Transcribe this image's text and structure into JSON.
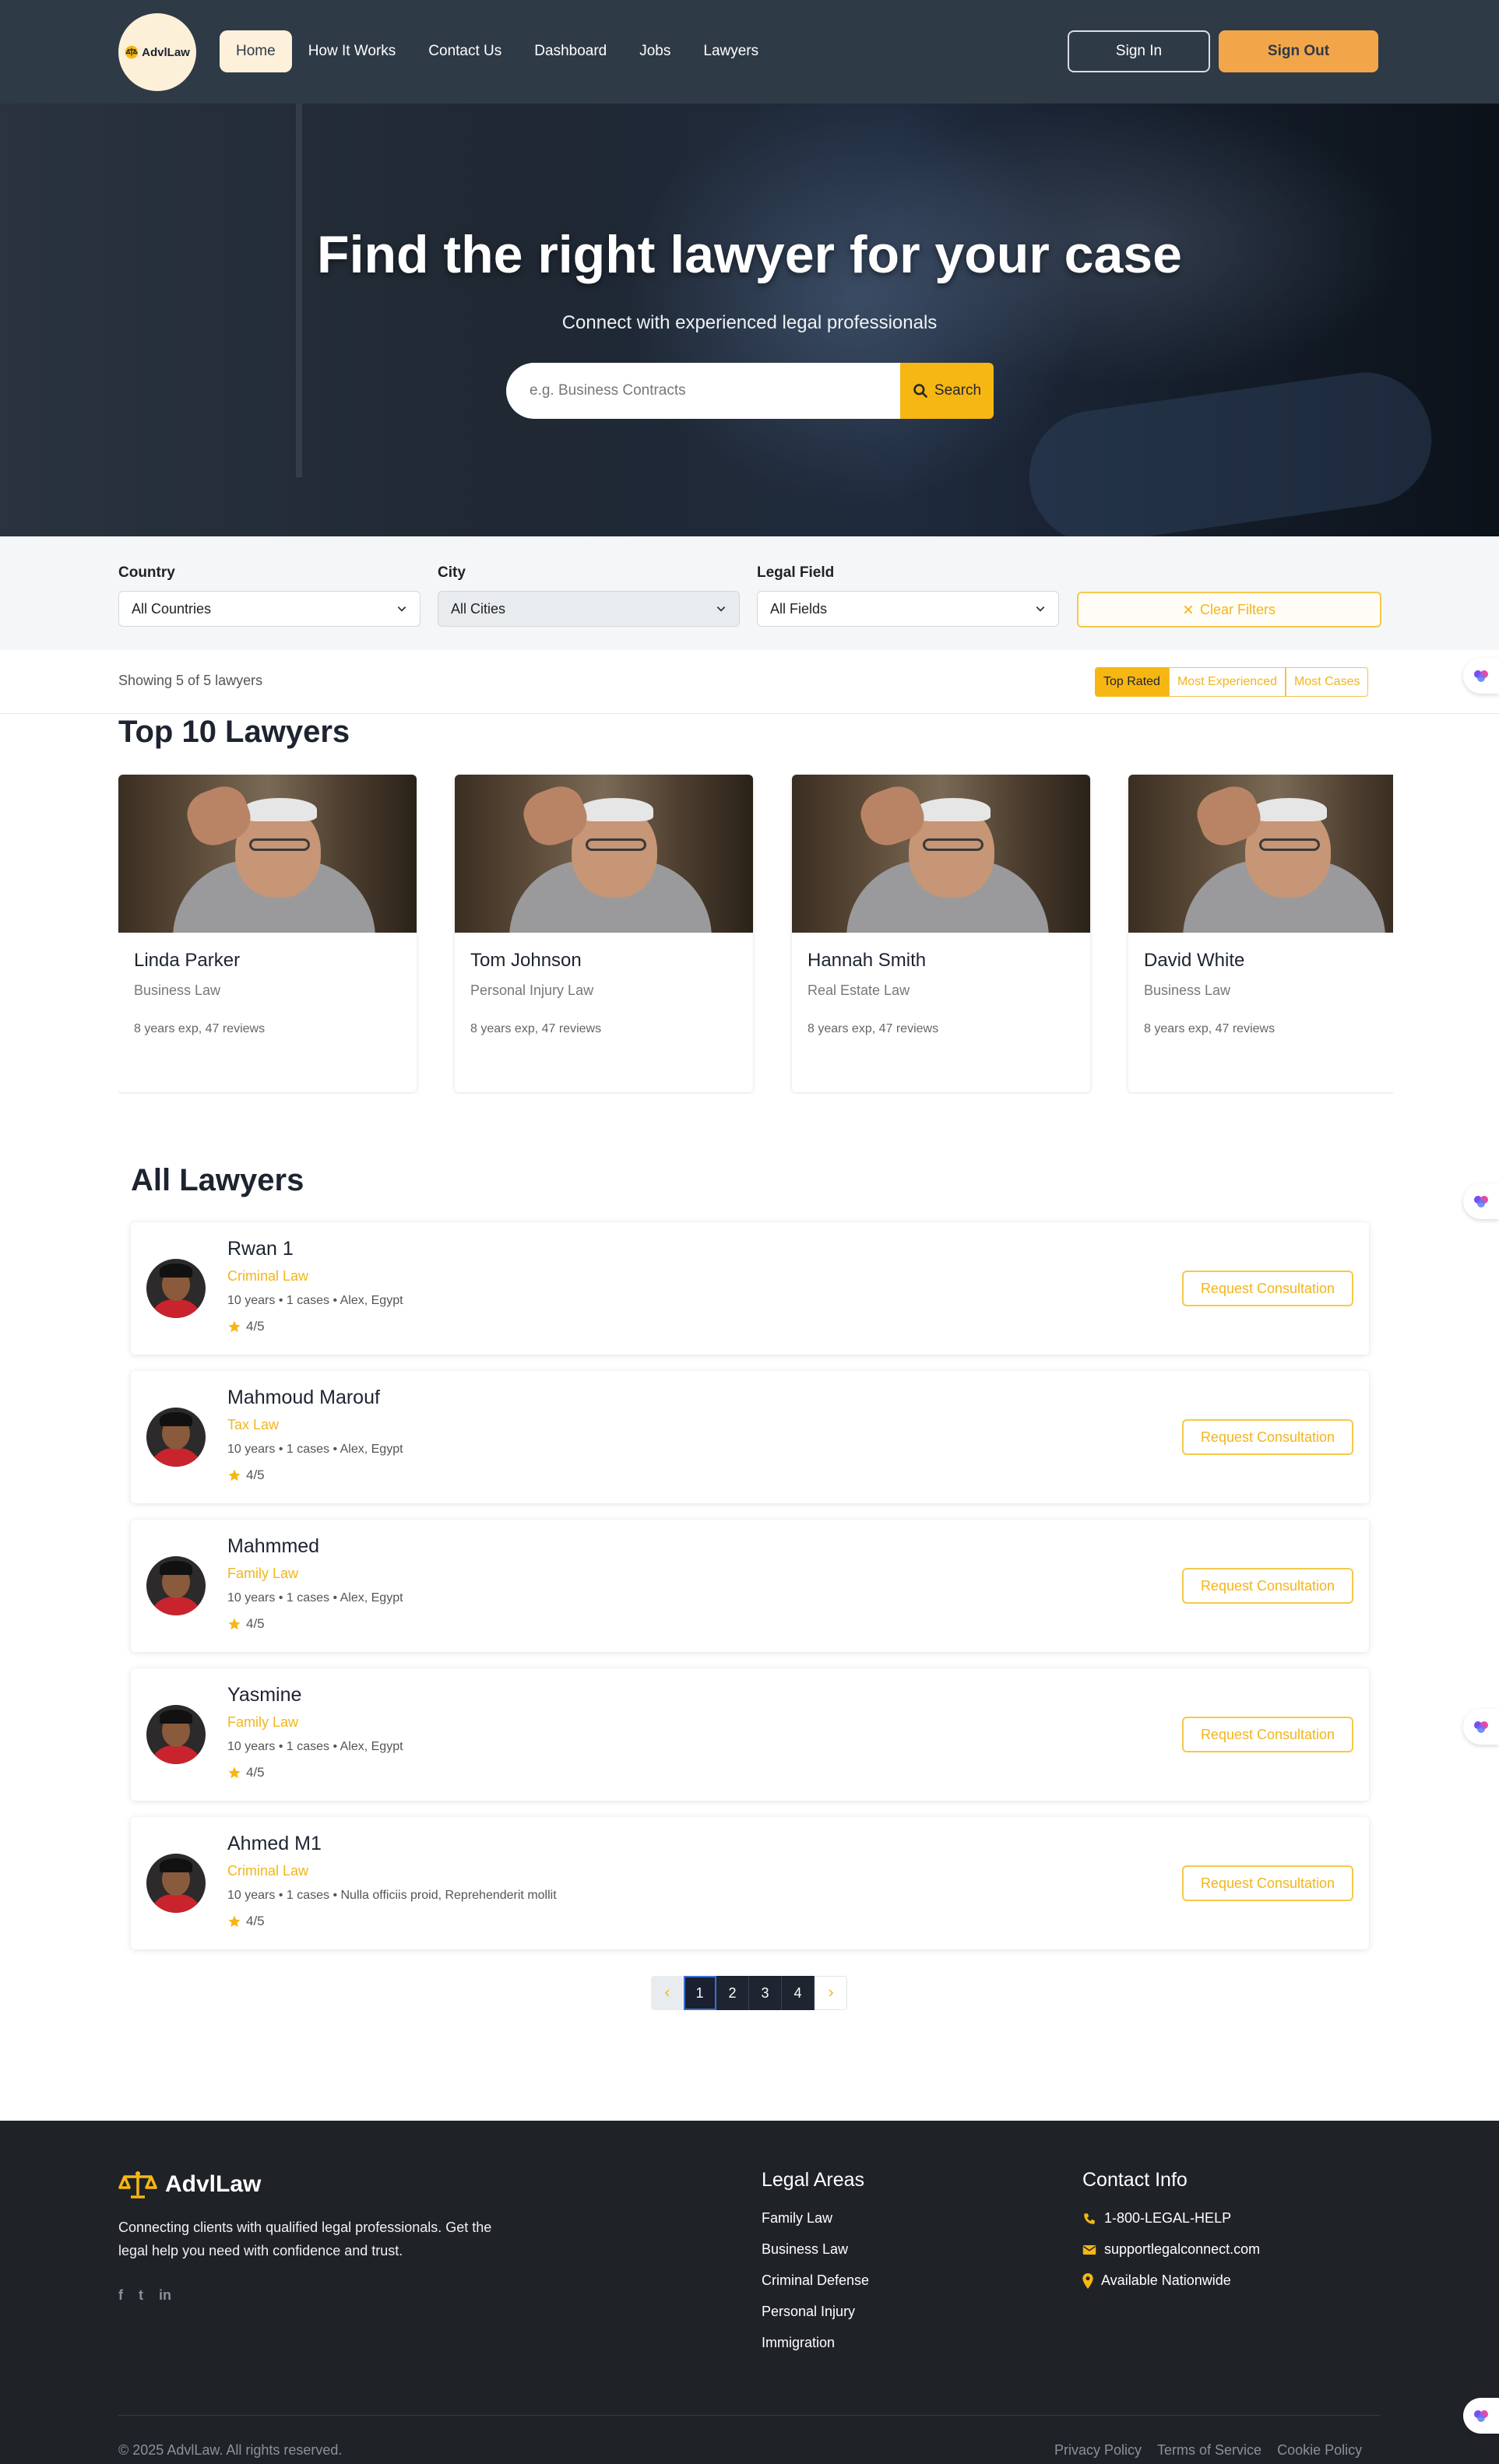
{
  "nav": {
    "logo_text": "AdvlLaw",
    "links": [
      {
        "label": "Home"
      },
      {
        "label": "How It Works"
      },
      {
        "label": "Contact Us"
      },
      {
        "label": "Dashboard"
      },
      {
        "label": "Jobs"
      },
      {
        "label": "Lawyers"
      }
    ],
    "sign_in": "Sign In",
    "sign_out": "Sign Out"
  },
  "hero": {
    "title": "Find the right lawyer for your case",
    "subtitle": "Connect with experienced legal professionals",
    "search_placeholder": "e.g. Business Contracts",
    "search_button": "Search"
  },
  "filters": {
    "country": {
      "label": "Country",
      "value": "All Countries"
    },
    "city": {
      "label": "City",
      "value": "All Cities"
    },
    "legal_field": {
      "label": "Legal Field",
      "value": "All Fields"
    },
    "clear": "Clear Filters"
  },
  "results": {
    "showing": "Showing 5 of 5 lawyers",
    "sort_options": [
      "Top Rated",
      "Most Experienced",
      "Most Cases"
    ],
    "active_sort": "Top Rated"
  },
  "top_lawyers": {
    "title": "Top 10 Lawyers",
    "cards": [
      {
        "name": "Linda Parker",
        "field": "Business Law",
        "exp": "8 years exp, 47 reviews"
      },
      {
        "name": "Tom Johnson",
        "field": "Personal Injury Law",
        "exp": "8 years exp, 47 reviews"
      },
      {
        "name": "Hannah Smith",
        "field": "Real Estate Law",
        "exp": "8 years exp, 47 reviews"
      },
      {
        "name": "David White",
        "field": "Business Law",
        "exp": "8 years exp, 47 reviews"
      }
    ]
  },
  "all_lawyers": {
    "title": "All Lawyers",
    "request_label": "Request Consultation",
    "items": [
      {
        "name": "Rwan 1",
        "field": "Criminal Law",
        "meta": "10 years • 1 cases • Alex, Egypt",
        "rating": "4/5"
      },
      {
        "name": "Mahmoud Marouf",
        "field": "Tax Law",
        "meta": "10 years • 1 cases • Alex, Egypt",
        "rating": "4/5"
      },
      {
        "name": "Mahmmed",
        "field": "Family Law",
        "meta": "10 years • 1 cases • Alex, Egypt",
        "rating": "4/5"
      },
      {
        "name": "Yasmine",
        "field": "Family Law",
        "meta": "10 years • 1 cases • Alex, Egypt",
        "rating": "4/5"
      },
      {
        "name": "Ahmed M1",
        "field": "Criminal Law",
        "meta": "10 years • 1 cases • Nulla officiis proid, Reprehenderit mollit",
        "rating": "4/5"
      }
    ]
  },
  "pagination": {
    "pages": [
      "1",
      "2",
      "3",
      "4"
    ],
    "current": "1"
  },
  "footer": {
    "brand": "AdvlLaw",
    "description": "Connecting clients with qualified legal professionals. Get the legal help you need with confidence and trust.",
    "social": [
      "f",
      "t",
      "in"
    ],
    "legal_areas": {
      "title": "Legal Areas",
      "items": [
        "Family Law",
        "Business Law",
        "Criminal Defense",
        "Personal Injury",
        "Immigration"
      ]
    },
    "contact": {
      "title": "Contact Info",
      "phone": "1-800-LEGAL-HELP",
      "email": "supportlegalconnect.com",
      "location": "Available Nationwide"
    },
    "copyright": "© 2025 AdvlLaw. All rights reserved.",
    "legal_links": [
      "Privacy Policy",
      "Terms of Service",
      "Cookie Policy"
    ]
  },
  "colors": {
    "nav_bg": "#2f3a47",
    "accent": "#f6b713",
    "sign_out_bg": "#f3a649",
    "footer_bg": "#1f2328"
  }
}
